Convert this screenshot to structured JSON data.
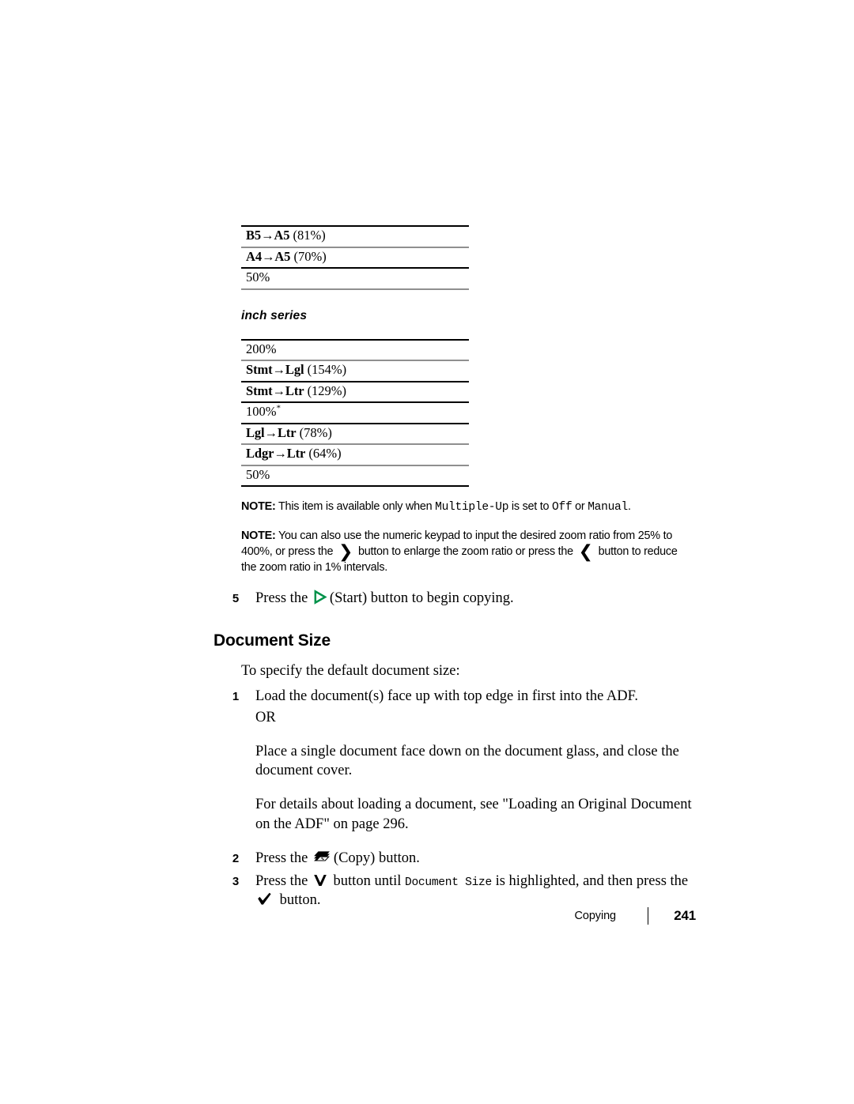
{
  "document": {
    "section_heading": "Document Size",
    "intro": "To specify the default document size:"
  },
  "metric_table": {
    "rows": [
      {
        "code": "B5→A5",
        "pct": "(81%)",
        "bold": true
      },
      {
        "code": "A4→A5",
        "pct": "(70%)",
        "bold": true
      },
      {
        "code": "50%",
        "pct": "",
        "bold": false
      }
    ]
  },
  "series_heading": "inch series",
  "inch_table": {
    "rows": [
      {
        "code": "200%",
        "pct": "",
        "bold": false,
        "star": false
      },
      {
        "code": "Stmt→Lgl",
        "pct": "(154%)",
        "bold": true,
        "star": false
      },
      {
        "code": "Stmt→Ltr",
        "pct": "(129%)",
        "bold": true,
        "star": false
      },
      {
        "code": "100%",
        "pct": "",
        "bold": false,
        "star": true
      },
      {
        "code": "Lgl→Ltr",
        "pct": "(78%)",
        "bold": true,
        "star": false
      },
      {
        "code": "Ldgr→Ltr",
        "pct": "(64%)",
        "bold": true,
        "star": false
      },
      {
        "code": "50%",
        "pct": "",
        "bold": false,
        "star": false
      }
    ]
  },
  "notes": [
    {
      "label": "NOTE:",
      "t1": " This item is available only when ",
      "m1": "Multiple-Up",
      "t2": " is set to ",
      "m2": "Off",
      "t3": " or ",
      "m3": "Manual",
      "t4": "."
    },
    {
      "label": "NOTE:",
      "t1": " You can also use the numeric keypad to input the desired zoom ratio from 25% to 400%, or press the ",
      "chev_right": "❯",
      "t2": " button to enlarge the zoom ratio or press the ",
      "chev_left": "❮",
      "t3": " button to reduce the zoom ratio in 1% intervals."
    }
  ],
  "steps": {
    "step5": {
      "num": "5",
      "pre": "Press the ",
      "icon": "start-icon",
      "post": "(Start) button to begin copying."
    },
    "step1": {
      "num": "1",
      "text": "Load the document(s) face up with top edge in first into the ADF."
    },
    "or_text": "OR",
    "para_glass": "Place a single document face down on the document glass, and close the document cover.",
    "para_details": "For details about loading a document, see \"Loading an Original Document on the ADF\" on page 296.",
    "step2": {
      "num": "2",
      "pre": "Press the ",
      "icon": "copy-icon",
      "post": "(Copy) button."
    },
    "step3": {
      "num": "3",
      "pre": "Press the ",
      "icon_down": "down-arrow-icon",
      "mid1": " button until ",
      "mono": "Document Size",
      "mid2": " is highlighted, and then press the ",
      "icon_check": "check-icon",
      "post": " button."
    }
  },
  "footer": {
    "label": "Copying",
    "page": "241"
  },
  "colors": {
    "start_green": "#00924a",
    "rule_dark": "#000000",
    "rule_gray": "#8f8f8f"
  }
}
